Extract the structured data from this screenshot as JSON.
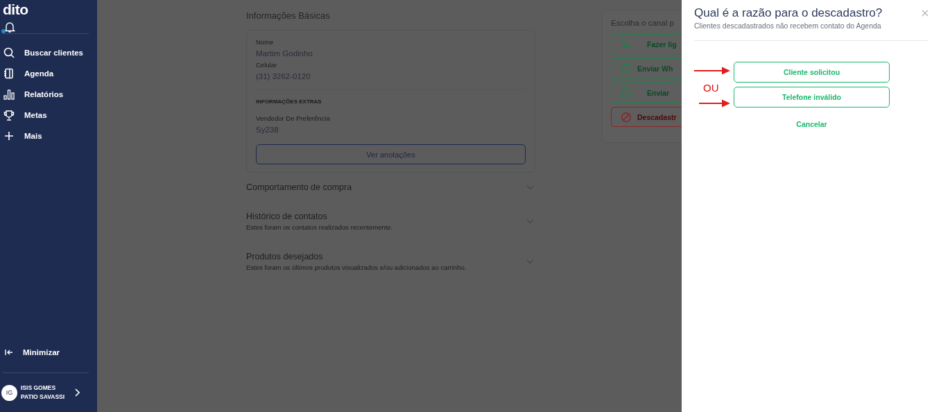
{
  "sidebar": {
    "logo": "dito",
    "notifications": {
      "unread": true
    },
    "nav": [
      {
        "label": "Buscar clientes"
      },
      {
        "label": "Agenda"
      },
      {
        "label": "Relatórios"
      },
      {
        "label": "Metas"
      },
      {
        "label": "Mais"
      }
    ],
    "minimize": "Minimizar",
    "user": {
      "initials": "IG",
      "name": "ISIS GOMES",
      "store": "PATIO SAVASSI"
    }
  },
  "basic_info": {
    "title": "Informações Básicas",
    "fields": [
      {
        "label": "Nome",
        "value": "Martim Godinho"
      },
      {
        "label": "Celular",
        "value": "(31) 3262-0120"
      }
    ],
    "extras_heading": "INFORMAÇÕES EXTRAS",
    "extras": [
      {
        "label": "Vendedor De Preferência",
        "value": "Sy238"
      }
    ],
    "notes_button": "Ver anotações"
  },
  "sections": [
    {
      "title": "Comportamento de compra"
    },
    {
      "title": "Histórico de contatos",
      "subtitle": "Estes foram os contatos realizados recentemente."
    },
    {
      "title": "Produtos desejados",
      "subtitle": "Estes foram os últimos produtos visualizados e/ou adicionados ao carrinho."
    }
  ],
  "channels": {
    "title": "Escolha o canal p",
    "buttons": [
      {
        "label": "Fazer lig",
        "kind": "call"
      },
      {
        "label": "Enviar Wh",
        "kind": "whatsapp"
      },
      {
        "label": "Enviar",
        "kind": "message"
      },
      {
        "label": "Descadastr",
        "kind": "unsubscribe"
      }
    ]
  },
  "dialog": {
    "title": "Qual é a razão para o descadastro?",
    "subtitle": "Clientes descadastrados não recebem contato do Agenda",
    "options": [
      {
        "label": "Cliente solicitou",
        "marked": true
      },
      {
        "label": "Telefone inválido",
        "marked": true
      }
    ],
    "annotation": "OU",
    "cancel": "Cancelar"
  }
}
